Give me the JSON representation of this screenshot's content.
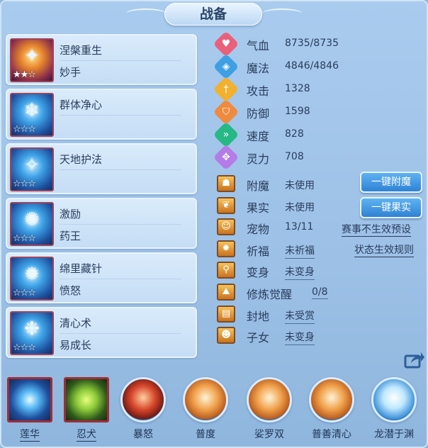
{
  "title": "战备",
  "skills": [
    {
      "name": "涅槃重生",
      "sub": "妙手",
      "stars": "★★☆",
      "icon": "phoenix-icon"
    },
    {
      "name": "群体净心",
      "sub": "",
      "stars": "☆☆☆",
      "icon": "ice-helm-icon"
    },
    {
      "name": "天地护法",
      "sub": "",
      "stars": "☆☆☆",
      "icon": "guardian-icon"
    },
    {
      "name": "激励",
      "sub": "药王",
      "stars": "☆☆☆",
      "icon": "spirit-icon"
    },
    {
      "name": "绵里藏针",
      "sub": "愤怒",
      "stars": "☆☆☆",
      "icon": "needle-icon"
    },
    {
      "name": "清心术",
      "sub": "易成长",
      "stars": "☆☆☆",
      "icon": "clear-mind-icon"
    }
  ],
  "stats": [
    {
      "label": "气血",
      "value": "8735/8735",
      "icon": "heart-icon",
      "color": "#e9607a"
    },
    {
      "label": "魔法",
      "value": "4846/4846",
      "icon": "mana-icon",
      "color": "#3f9fe3"
    },
    {
      "label": "攻击",
      "value": "1328",
      "icon": "sword-icon",
      "color": "#f2b02e"
    },
    {
      "label": "防御",
      "value": "1598",
      "icon": "shield-icon",
      "color": "#f08a3e"
    },
    {
      "label": "速度",
      "value": "828",
      "icon": "speed-icon",
      "color": "#27b886"
    },
    {
      "label": "灵力",
      "value": "708",
      "icon": "spirit-power-icon",
      "color": "#b57be6"
    }
  ],
  "attrs": [
    {
      "label": "附魔",
      "value": "未使用",
      "icon": "enchant-icon",
      "underline": false
    },
    {
      "label": "果实",
      "value": "未使用",
      "icon": "fruit-icon",
      "underline": false
    },
    {
      "label": "宠物",
      "value": "13/11",
      "icon": "pet-icon",
      "underline": false
    },
    {
      "label": "祈福",
      "value": "未祈福",
      "icon": "blessing-icon",
      "underline": true
    },
    {
      "label": "变身",
      "value": "未变身",
      "icon": "transform-icon",
      "underline": true
    },
    {
      "label": "修炼觉醒",
      "value": "0/8",
      "icon": "cultivation-icon",
      "underline": true
    },
    {
      "label": "封地",
      "value": "未受赏",
      "icon": "fief-icon",
      "underline": true
    },
    {
      "label": "子女",
      "value": "未变身",
      "icon": "child-icon",
      "underline": true
    }
  ],
  "buttons": {
    "enchant": "一键附魔",
    "fruit": "一键果实"
  },
  "links": {
    "preset": "赛事不生效预设",
    "rules": "状态生效规则"
  },
  "footer": [
    {
      "label": "莲华",
      "icon": "lotus-icon",
      "style": "sq",
      "underline": true
    },
    {
      "label": "忍犬",
      "icon": "wolf-icon",
      "style": "sq dog",
      "underline": true
    },
    {
      "label": "暴怒",
      "icon": "rage-icon",
      "style": "red",
      "underline": false
    },
    {
      "label": "普度",
      "icon": "hand-icon",
      "style": "",
      "underline": false
    },
    {
      "label": "娑罗双",
      "icon": "palm-icon",
      "style": "",
      "underline": false
    },
    {
      "label": "普善清心",
      "icon": "fist-icon",
      "style": "",
      "underline": false
    },
    {
      "label": "龙潜于渊",
      "icon": "dragon-icon",
      "style": "ice",
      "underline": false
    }
  ]
}
